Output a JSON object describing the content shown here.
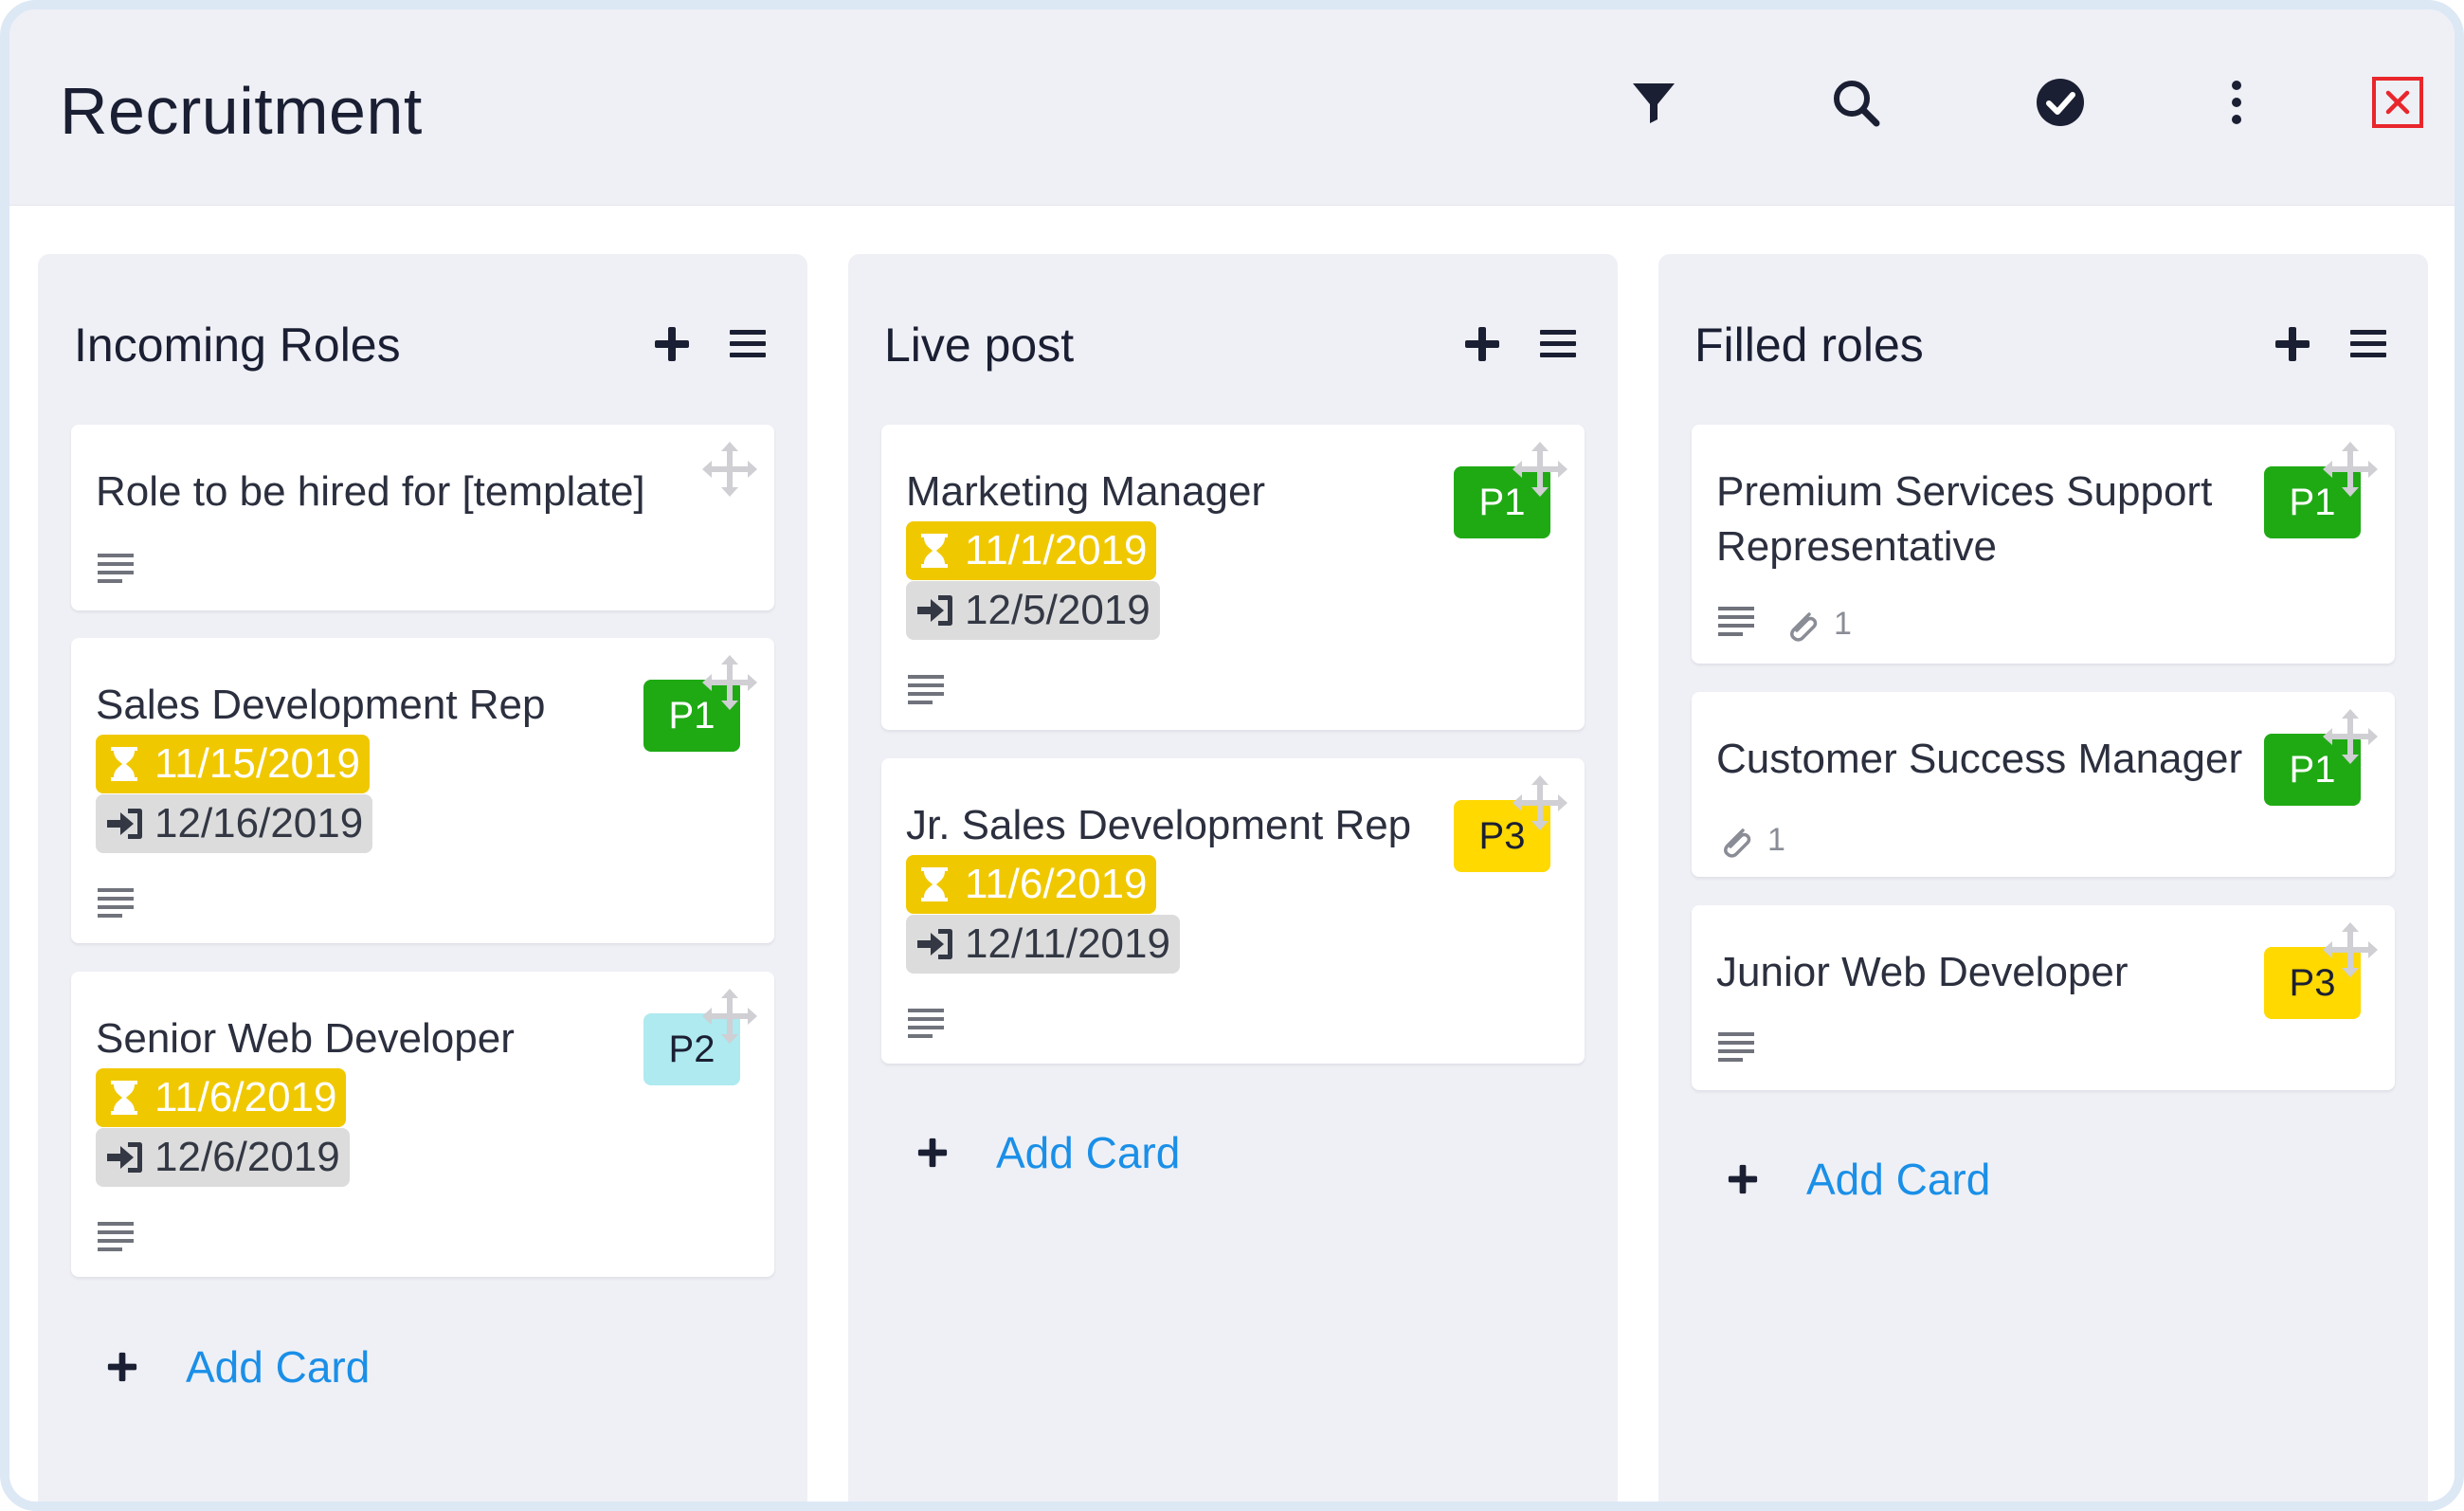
{
  "board": {
    "title": "Recruitment"
  },
  "header_icons": [
    "filter-icon",
    "search-icon",
    "check-circle-icon",
    "more-vertical-icon",
    "close-icon"
  ],
  "colors": {
    "p1": "#1faa14",
    "p2": "#aeeaf0",
    "p3": "#ffd900",
    "due": "#f0c800",
    "start": "#dcdcdc",
    "link": "#1a8fe8",
    "close": "#e8262c"
  },
  "columns": [
    {
      "title": "Incoming Roles",
      "add_card_label": "Add Card",
      "cards": [
        {
          "title": "Role to be hired for [template]",
          "priority": "",
          "due": "",
          "start": "",
          "has_description": true
        },
        {
          "title": "Sales Development Rep",
          "priority": "P1",
          "due": "11/15/2019",
          "start": "12/16/2019",
          "has_description": true
        },
        {
          "title": "Senior Web Developer",
          "priority": "P2",
          "due": "11/6/2019",
          "start": "12/6/2019",
          "has_description": true
        }
      ]
    },
    {
      "title": "Live post",
      "add_card_label": "Add Card",
      "cards": [
        {
          "title": "Marketing Manager",
          "priority": "P1",
          "due": "11/1/2019",
          "start": "12/5/2019",
          "has_description": true
        },
        {
          "title": "Jr. Sales Development Rep",
          "priority": "P3",
          "due": "11/6/2019",
          "start": "12/11/2019",
          "has_description": true
        }
      ]
    },
    {
      "title": "Filled roles",
      "add_card_label": "Add Card",
      "cards": [
        {
          "title": "Premium Services Support Representative",
          "priority": "P1",
          "has_description": true,
          "attachments": "1"
        },
        {
          "title": "Customer Success Manager",
          "priority": "P1",
          "has_description": false,
          "attachments": "1"
        },
        {
          "title": "Junior Web Developer",
          "priority": "P3",
          "has_description": true
        }
      ]
    }
  ]
}
